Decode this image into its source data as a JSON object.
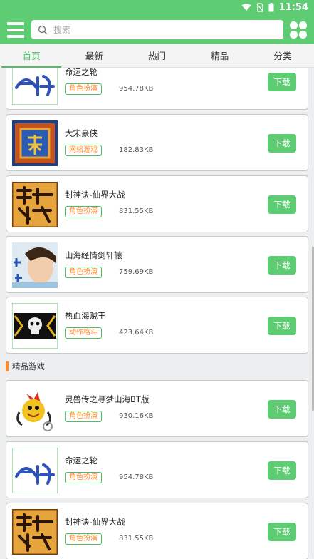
{
  "status_bar": {
    "time": "11:54"
  },
  "search": {
    "placeholder": "搜索"
  },
  "tabs": [
    {
      "label": "首页",
      "active": true
    },
    {
      "label": "最新"
    },
    {
      "label": "热门"
    },
    {
      "label": "精品"
    },
    {
      "label": "分类"
    }
  ],
  "list_top": [
    {
      "name": "命运之轮",
      "tag": "角色扮演",
      "size": "954.78KB",
      "download": "下载",
      "icon": "destiny-wheel-icon"
    },
    {
      "name": "大宋豪侠",
      "tag": "网络游戏",
      "size": "182.83KB",
      "download": "下载",
      "icon": "song-hero-icon"
    },
    {
      "name": "封神诀-仙界大战",
      "tag": "角色扮演",
      "size": "831.55KB",
      "download": "下载",
      "icon": "fengshen-icon"
    },
    {
      "name": "山海经情剑轩辕",
      "tag": "角色扮演",
      "size": "759.69KB",
      "download": "下载",
      "icon": "shanhai-icon"
    },
    {
      "name": "热血海贼王",
      "tag": "动作格斗",
      "size": "423.64KB",
      "download": "下载",
      "icon": "pirate-skull-icon"
    }
  ],
  "section": {
    "title": "精品游戏"
  },
  "list_featured": [
    {
      "name": "灵兽传之寻梦山海BT版",
      "tag": "角色扮演",
      "size": "930.16KB",
      "download": "下载",
      "icon": "spirit-beast-icon"
    },
    {
      "name": "命运之轮",
      "tag": "角色扮演",
      "size": "954.78KB",
      "download": "下载",
      "icon": "destiny-wheel-icon"
    },
    {
      "name": "封神诀-仙界大战",
      "tag": "角色扮演",
      "size": "831.55KB",
      "download": "下载",
      "icon": "fengshen-icon"
    }
  ],
  "colors": {
    "accent": "#5ecc73",
    "tag_text": "#ff8a2a",
    "tag_border": "#4cc05f"
  }
}
